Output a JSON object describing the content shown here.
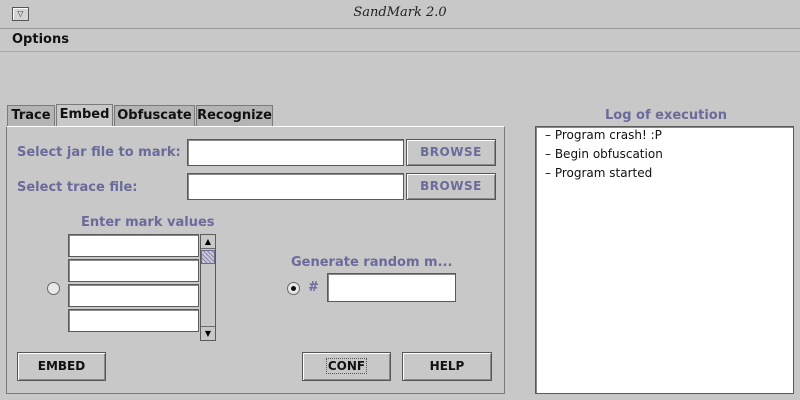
{
  "window": {
    "title": "SandMark 2.0",
    "menu_icon": "triangle-down-icon"
  },
  "menubar": {
    "options": "Options"
  },
  "tabs": [
    {
      "label": "Trace",
      "active": false
    },
    {
      "label": "Embed",
      "active": true
    },
    {
      "label": "Obfuscate",
      "active": false
    },
    {
      "label": "Recognize",
      "active": false
    }
  ],
  "embed": {
    "jar_label": "Select jar file to mark:",
    "jar_value": "",
    "trace_label": "Select trace file:",
    "trace_value": "",
    "browse_label": "BROWSE",
    "mark_values_label": "Enter mark values",
    "mark_values": [
      "",
      "",
      "",
      ""
    ],
    "random_label": "Generate random m...",
    "hash_label": "#",
    "random_value": "",
    "embed_button": "EMBED",
    "conf_button": "CONF",
    "help_button": "HELP"
  },
  "log": {
    "title": "Log of execution",
    "items": [
      "Program crash! :P",
      "Begin obfuscation",
      "Program started"
    ]
  },
  "colors": {
    "label_blue": "#6a6a9c",
    "background": "#c8c8c8"
  }
}
